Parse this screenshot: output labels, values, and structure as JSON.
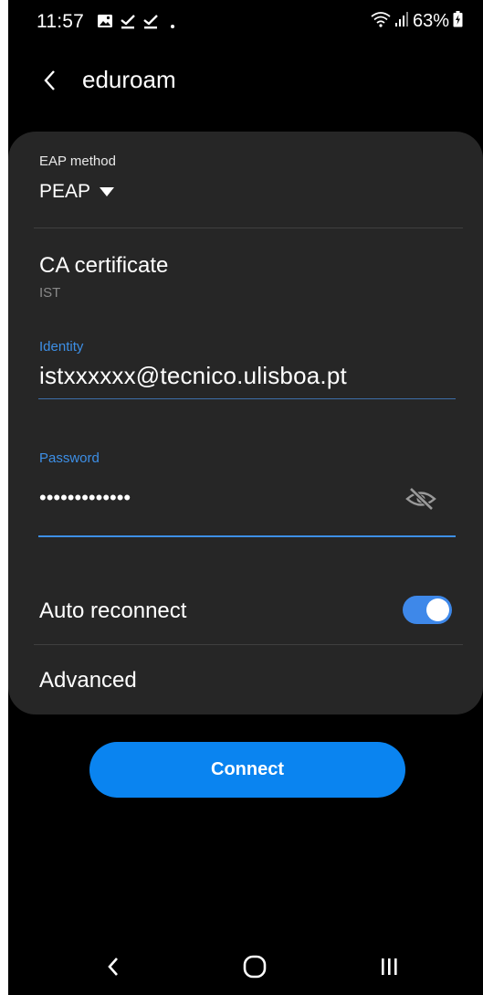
{
  "status_bar": {
    "time": "11:57",
    "battery": "63%",
    "left_icons": [
      "image-icon",
      "download-done-icon",
      "download-done-icon",
      "dot-icon"
    ],
    "right_icons": [
      "wifi-icon",
      "signal-icon",
      "battery-charging-icon"
    ]
  },
  "header": {
    "title": "eduroam"
  },
  "form": {
    "eap_method": {
      "label": "EAP method",
      "value": "PEAP"
    },
    "ca_certificate": {
      "label": "CA certificate",
      "value": "IST"
    },
    "identity": {
      "label": "Identity",
      "value": "istxxxxxx@tecnico.ulisboa.pt"
    },
    "password": {
      "label": "Password",
      "value": "•••••••••••••"
    },
    "auto_reconnect": {
      "label": "Auto reconnect",
      "enabled": true
    },
    "advanced": {
      "label": "Advanced"
    }
  },
  "connect": {
    "label": "Connect"
  },
  "colors": {
    "background": "#000000",
    "card": "#262626",
    "accent": "#3d8fe6",
    "button": "#0a84f0"
  },
  "nav_bar": {
    "items": [
      "back-nav-icon",
      "home-icon",
      "recent-apps-icon"
    ]
  }
}
